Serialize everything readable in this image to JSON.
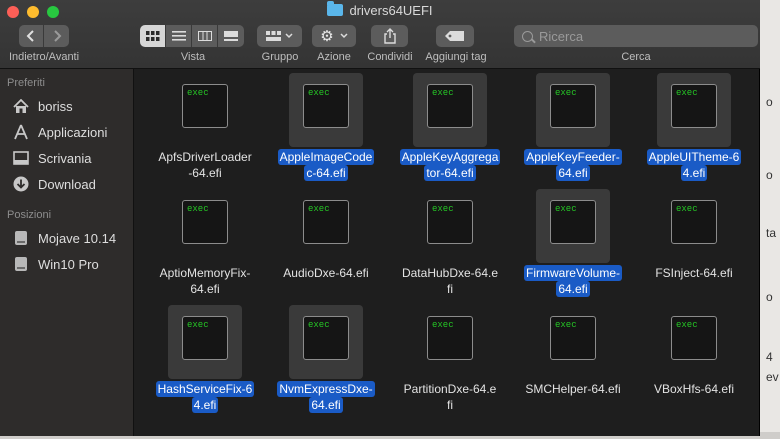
{
  "window": {
    "title": "drivers64UEFI"
  },
  "toolbar": {
    "nav_label": "Indietro/Avanti",
    "view_label": "Vista",
    "group_label": "Gruppo",
    "action_label": "Azione",
    "share_label": "Condividi",
    "tags_label": "Aggiungi tag",
    "search_label": "Cerca",
    "search_placeholder": "Ricerca",
    "back_icon": "chevron-left-icon",
    "forward_icon": "chevron-right-icon"
  },
  "sidebar": {
    "favorites_header": "Preferiti",
    "favorites": [
      {
        "label": "boriss",
        "icon": "home-icon"
      },
      {
        "label": "Applicazioni",
        "icon": "applications-icon"
      },
      {
        "label": "Scrivania",
        "icon": "desktop-icon"
      },
      {
        "label": "Download",
        "icon": "download-icon"
      }
    ],
    "locations_header": "Posizioni",
    "locations": [
      {
        "label": "Mojave 10.14",
        "icon": "disk-icon"
      },
      {
        "label": "Win10 Pro",
        "icon": "disk-icon"
      }
    ]
  },
  "files": [
    {
      "line1": "ApfsDriverLoader",
      "line2": "-64.efi",
      "selected": false
    },
    {
      "line1": "AppleImageCode",
      "line2": "c-64.efi",
      "selected": true
    },
    {
      "line1": "AppleKeyAggrega",
      "line2": "tor-64.efi",
      "selected": true
    },
    {
      "line1": "AppleKeyFeeder-",
      "line2": "64.efi",
      "selected": true
    },
    {
      "line1": "AppleUITheme-6",
      "line2": "4.efi",
      "selected": true
    },
    {
      "line1": "AptioMemoryFix-",
      "line2": "64.efi",
      "selected": false
    },
    {
      "line1": "AudioDxe-64.efi",
      "line2": "",
      "selected": false
    },
    {
      "line1": "DataHubDxe-64.e",
      "line2": "fi",
      "selected": false
    },
    {
      "line1": "FirmwareVolume-",
      "line2": "64.efi",
      "selected": true
    },
    {
      "line1": "FSInject-64.efi",
      "line2": "",
      "selected": false
    },
    {
      "line1": "HashServiceFix-6",
      "line2": "4.efi",
      "selected": true
    },
    {
      "line1": "NvmExpressDxe-",
      "line2": "64.efi",
      "selected": true
    },
    {
      "line1": "PartitionDxe-64.e",
      "line2": "fi",
      "selected": false
    },
    {
      "line1": "SMCHelper-64.efi",
      "line2": "",
      "selected": false
    },
    {
      "line1": "VBoxHfs-64.efi",
      "line2": "",
      "selected": false
    }
  ],
  "exec_label": "exec",
  "background_fragments": [
    "o",
    "o",
    "ta",
    "o",
    "4",
    "ev"
  ]
}
